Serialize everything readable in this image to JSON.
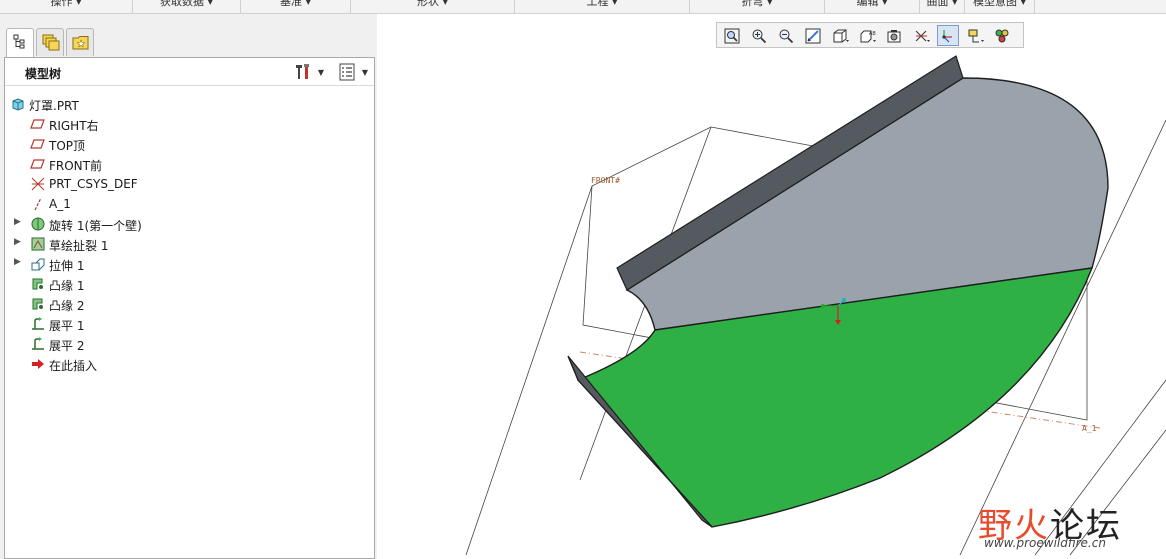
{
  "ribbon": {
    "groups": [
      "操作 ▾",
      "获取数据 ▾",
      "基准 ▾",
      "形状 ▾",
      "工程 ▾",
      "折弯 ▾",
      "编辑 ▾",
      "曲面 ▾",
      "模型意图 ▾"
    ]
  },
  "panel": {
    "tabs": [
      "model-tree-tab-icon",
      "layers-tab-icon",
      "favorites-tab-icon"
    ],
    "title": "模型树"
  },
  "tree": {
    "items": [
      {
        "label": "灯罩.PRT",
        "icon": "part-icon",
        "expandable": false
      },
      {
        "label": "RIGHT右",
        "icon": "datum-plane-icon",
        "expandable": false
      },
      {
        "label": "TOP顶",
        "icon": "datum-plane-icon",
        "expandable": false
      },
      {
        "label": "FRONT前",
        "icon": "datum-plane-icon",
        "expandable": false
      },
      {
        "label": "PRT_CSYS_DEF",
        "icon": "csys-icon",
        "expandable": false
      },
      {
        "label": "A_1",
        "icon": "datum-axis-icon",
        "expandable": false
      },
      {
        "label": "旋转 1(第一个壁)",
        "icon": "revolve-wall-icon",
        "expandable": true
      },
      {
        "label": "草绘扯裂 1",
        "icon": "sketch-rip-icon",
        "expandable": true
      },
      {
        "label": "拉伸 1",
        "icon": "extrude-icon",
        "expandable": true
      },
      {
        "label": "凸缘 1",
        "icon": "flange-icon",
        "expandable": false
      },
      {
        "label": "凸缘 2",
        "icon": "flange-icon",
        "expandable": false
      },
      {
        "label": "展平 1",
        "icon": "unbend-icon",
        "expandable": false
      },
      {
        "label": "展平 2",
        "icon": "unbend-icon",
        "expandable": false
      },
      {
        "label": "在此插入",
        "icon": "insert-here-icon",
        "expandable": false
      }
    ]
  },
  "view_toolbar": {
    "buttons": [
      "refit-icon",
      "zoom-in-icon",
      "zoom-out-icon",
      "repaint-icon",
      "display-style-icon",
      "saved-views-icon",
      "view-manager-icon",
      "datum-display-icon",
      "spin-center-icon",
      "annotation-display-icon",
      "appearance-icon"
    ],
    "active": "spin-center-icon"
  },
  "graphics": {
    "datum_labels": {
      "front": "FRONT#",
      "axis": "A_1"
    },
    "colors": {
      "flat_surface": "#2eb044",
      "curved_surface": "#9ba3aa",
      "flange_dark": "#555a60",
      "datum_line": "#cc8866"
    }
  },
  "watermark": {
    "text_a": "野火",
    "text_b": "论坛",
    "url": "www.proewildfire.cn"
  }
}
